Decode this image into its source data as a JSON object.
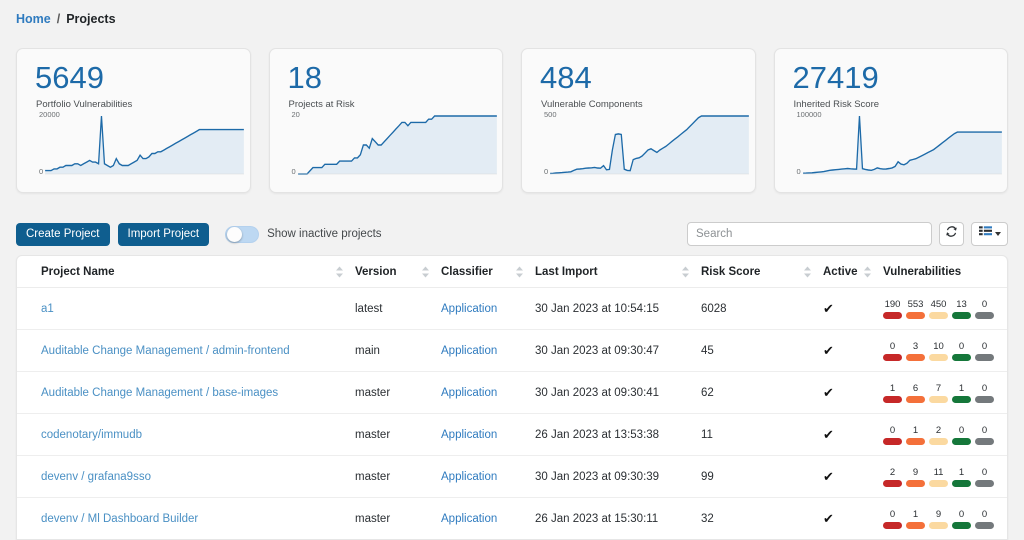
{
  "breadcrumb": {
    "home": "Home",
    "separator": "/",
    "current": "Projects"
  },
  "cards": [
    {
      "value": "5649",
      "label": "Portfolio Vulnerabilities",
      "axis_top": "20000",
      "axis_bottom": "0",
      "accent": "#1d6aa8",
      "series": [
        2,
        2,
        2,
        3,
        3,
        4,
        4,
        5,
        5,
        5,
        6,
        6,
        5,
        6,
        7,
        8,
        7,
        7,
        6,
        34,
        6,
        5,
        4,
        5,
        9,
        6,
        5,
        5,
        5,
        6,
        7,
        8,
        11,
        9,
        9,
        10,
        12,
        12,
        13,
        13,
        14,
        15,
        16,
        17,
        18,
        19,
        20,
        21,
        22,
        23,
        24,
        25,
        26,
        26,
        26,
        26,
        26,
        26,
        26,
        26,
        26,
        26,
        26,
        26,
        26,
        26,
        26,
        26
      ]
    },
    {
      "value": "18",
      "label": "Projects at Risk",
      "axis_top": "20",
      "axis_bottom": "0",
      "accent": "#1d6aa8",
      "series": [
        0,
        0,
        0,
        0,
        1,
        2,
        2,
        2,
        2,
        3,
        3,
        3,
        3,
        3,
        4,
        4,
        4,
        4,
        4,
        5,
        5,
        6,
        9,
        9,
        8,
        11,
        10,
        9,
        9,
        10,
        11,
        12,
        13,
        14,
        15,
        16,
        16,
        15,
        16,
        16,
        16,
        16,
        16,
        16,
        17,
        17,
        18,
        18,
        18,
        18,
        18,
        18,
        18,
        18,
        18,
        18,
        18,
        18,
        18,
        18,
        18,
        18,
        18,
        18,
        18,
        18,
        18,
        18
      ]
    },
    {
      "value": "484",
      "label": "Vulnerable Components",
      "axis_top": "500",
      "axis_bottom": "0",
      "accent": "#1d6aa8",
      "series": [
        5,
        6,
        8,
        10,
        12,
        14,
        16,
        18,
        30,
        40,
        42,
        44,
        48,
        50,
        52,
        55,
        50,
        48,
        70,
        35,
        38,
        200,
        330,
        335,
        330,
        40,
        30,
        28,
        120,
        130,
        135,
        150,
        175,
        200,
        210,
        195,
        180,
        200,
        215,
        230,
        250,
        270,
        290,
        310,
        330,
        350,
        370,
        395,
        420,
        445,
        470,
        484,
        484,
        484,
        484,
        484,
        484,
        484,
        484,
        484,
        484,
        484,
        484,
        484,
        484,
        484,
        484,
        484
      ]
    },
    {
      "value": "27419",
      "label": "Inherited Risk Score",
      "axis_top": "100000",
      "axis_bottom": "0",
      "accent": "#1d6aa8",
      "series": [
        500,
        600,
        700,
        800,
        1000,
        1200,
        1400,
        1600,
        2000,
        2400,
        2600,
        2800,
        3000,
        3200,
        3400,
        3600,
        3400,
        3300,
        3200,
        38000,
        3500,
        3000,
        2600,
        2400,
        3000,
        4000,
        3500,
        3200,
        3300,
        3600,
        4000,
        5000,
        8000,
        6500,
        6000,
        7000,
        9000,
        9500,
        10000,
        11000,
        12000,
        13000,
        14000,
        15000,
        16000,
        17500,
        19000,
        20500,
        22000,
        23500,
        25000,
        26500,
        27419,
        27419,
        27419,
        27419,
        27419,
        27419,
        27419,
        27419,
        27419,
        27419,
        27419,
        27419,
        27419,
        27419,
        27419,
        27419
      ]
    }
  ],
  "toolbar": {
    "create_project": "Create Project",
    "import_project": "Import Project",
    "show_inactive_label": "Show inactive projects",
    "show_inactive_on": false,
    "search_placeholder": "Search",
    "search_value": "",
    "refresh_icon": "refresh-icon",
    "columns_icon": "columns-icon"
  },
  "table": {
    "columns": [
      {
        "label": "Project Name",
        "sortable": true
      },
      {
        "label": "Version",
        "sortable": true
      },
      {
        "label": "Classifier",
        "sortable": true
      },
      {
        "label": "Last Import",
        "sortable": true
      },
      {
        "label": "Risk Score",
        "sortable": true
      },
      {
        "label": "Active",
        "sortable": true
      },
      {
        "label": "Vulnerabilities",
        "sortable": false
      }
    ],
    "severity_colors": {
      "critical": "#c62828",
      "high": "#f4703a",
      "medium": "#fbd9a0",
      "low": "#15773a",
      "unassigned": "#74797c"
    },
    "rows": [
      {
        "name": "a1",
        "version": "latest",
        "classifier": "Application",
        "last_import": "30 Jan 2023 at 10:54:15",
        "risk_score": "6028",
        "active": true,
        "active_icon": "check-icon",
        "vulnerabilities": [
          "190",
          "553",
          "450",
          "13",
          "0"
        ]
      },
      {
        "name": "Auditable Change Management / admin-frontend",
        "version": "main",
        "classifier": "Application",
        "last_import": "30 Jan 2023 at 09:30:47",
        "risk_score": "45",
        "active": true,
        "active_icon": "check-icon",
        "vulnerabilities": [
          "0",
          "3",
          "10",
          "0",
          "0"
        ]
      },
      {
        "name": "Auditable Change Management / base-images",
        "version": "master",
        "classifier": "Application",
        "last_import": "30 Jan 2023 at 09:30:41",
        "risk_score": "62",
        "active": true,
        "active_icon": "check-icon",
        "vulnerabilities": [
          "1",
          "6",
          "7",
          "1",
          "0"
        ]
      },
      {
        "name": "codenotary/immudb",
        "version": "master",
        "classifier": "Application",
        "last_import": "26 Jan 2023 at 13:53:38",
        "risk_score": "11",
        "active": true,
        "active_icon": "check-icon",
        "vulnerabilities": [
          "0",
          "1",
          "2",
          "0",
          "0"
        ]
      },
      {
        "name": "devenv / grafana9sso",
        "version": "master",
        "classifier": "Application",
        "last_import": "30 Jan 2023 at 09:30:39",
        "risk_score": "99",
        "active": true,
        "active_icon": "check-icon",
        "vulnerabilities": [
          "2",
          "9",
          "11",
          "1",
          "0"
        ]
      },
      {
        "name": "devenv / Ml Dashboard Builder",
        "version": "master",
        "classifier": "Application",
        "last_import": "26 Jan 2023 at 15:30:11",
        "risk_score": "32",
        "active": true,
        "active_icon": "check-icon",
        "vulnerabilities": [
          "0",
          "1",
          "9",
          "0",
          "0"
        ]
      }
    ]
  }
}
